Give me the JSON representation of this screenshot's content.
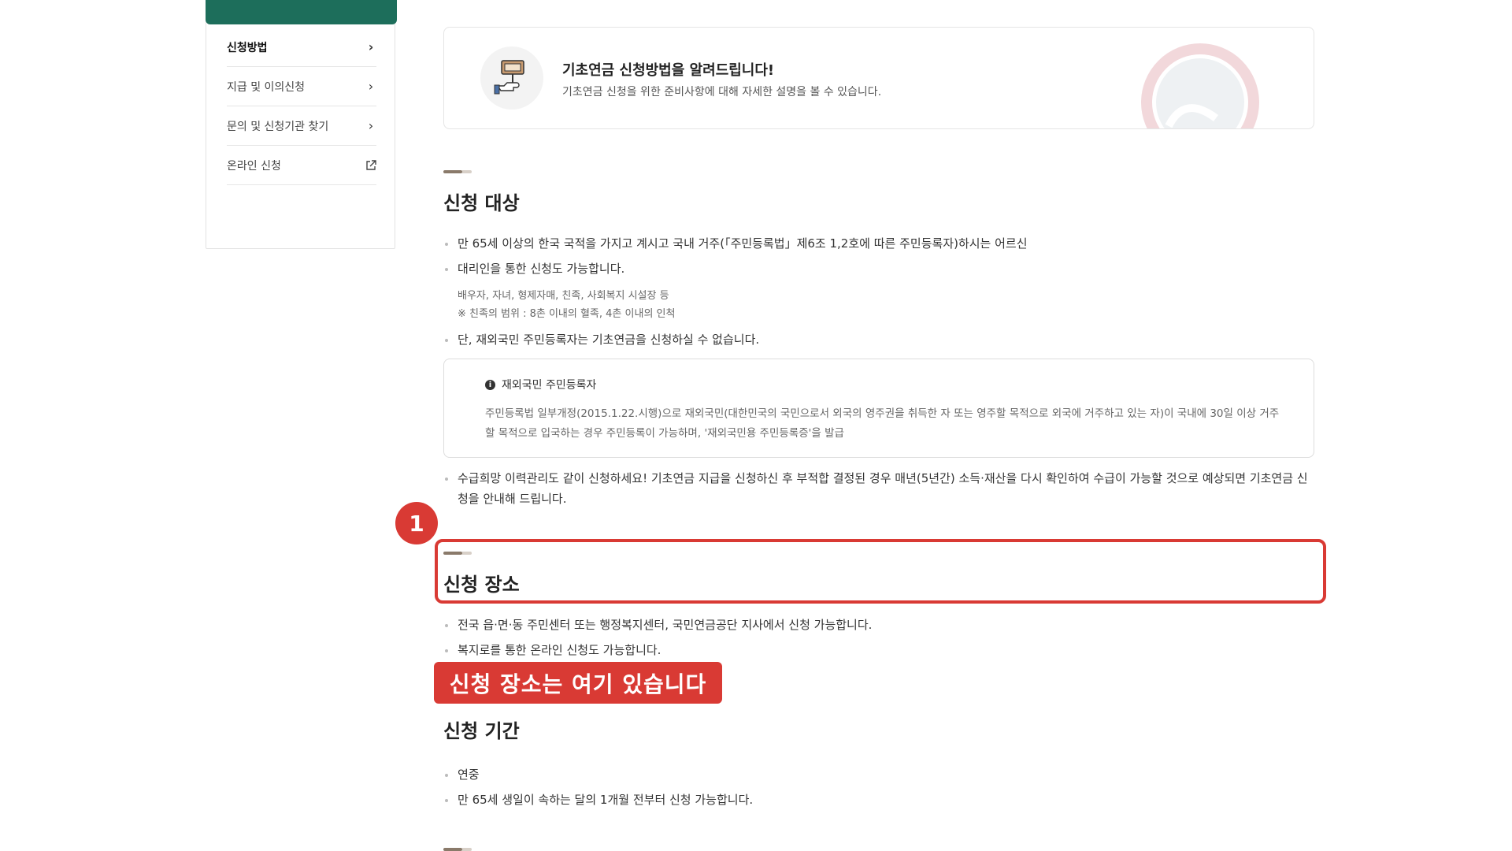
{
  "sidebar": {
    "items": [
      {
        "label": "신청방법",
        "icon": "chevron-right-icon"
      },
      {
        "label": "지급 및 이의신청",
        "icon": "chevron-right-icon"
      },
      {
        "label": "문의 및 신청기관 찾기",
        "icon": "chevron-right-icon"
      },
      {
        "label": "온라인 신청",
        "icon": "external-link-icon"
      }
    ]
  },
  "intro": {
    "title": "기초연금 신청방법을 알려드립니다!",
    "desc": "기초연금 신청을 위한 준비사항에 대해 자세한 설명을 볼 수 있습니다.",
    "icon": "hand-sign-icon"
  },
  "target": {
    "title": "신청 대상",
    "bullet1": "만 65세 이상의 한국 국적을 가지고 계시고 국내 거주(「주민등록법」제6조 1,2호에 따른 주민등록자)하시는 어르신",
    "bullet2": "대리인을 통한 신청도 가능합니다.",
    "note1": "배우자, 자녀, 형제자매, 친족, 사회복지 시설장 등",
    "note2": "※ 친족의 범위 : 8촌 이내의 혈족, 4촌 이내의 인척",
    "bullet3": "단, 재외국민 주민등록자는 기초연금을 신청하실 수 없습니다.",
    "info_title": "재외국민 주민등록자",
    "info_text": "주민등록법 일부개정(2015.1.22.시행)으로 재외국민(대한민국의 국민으로서 외국의 영주권을 취득한 자 또는 영주할 목적으로 외국에 거주하고 있는 자)이 국내에 30일 이상 거주할 목적으로 입국하는 경우 주민등록이 가능하며, '재외국민용 주민등록증'을 발급",
    "bullet4": "수급희망 이력관리도 같이 신청하세요! 기초연금 지급을 신청하신 후 부적합 결정된 경우 매년(5년간) 소득·재산을 다시 확인하여 수급이 가능할 것으로 예상되면 기초연금 신청을 안내해 드립니다."
  },
  "place": {
    "title": "신청 장소",
    "bullet1": "전국 읍·면·동 주민센터 또는 행정복지센터, 국민연금공단 지사에서 신청 가능합니다.",
    "bullet2": "복지로를 통한 온라인 신청도 가능합니다."
  },
  "period": {
    "title": "신청 기간",
    "bullet1": "연중",
    "bullet2": "만 65세 생일이 속하는 달의 1개월 전부터 신청 가능합니다."
  },
  "annotation": {
    "marker": "1",
    "callout": "신청 장소는 여기 있습니다",
    "color": "#d93a34"
  },
  "colors": {
    "brand": "#1d6e5b"
  }
}
